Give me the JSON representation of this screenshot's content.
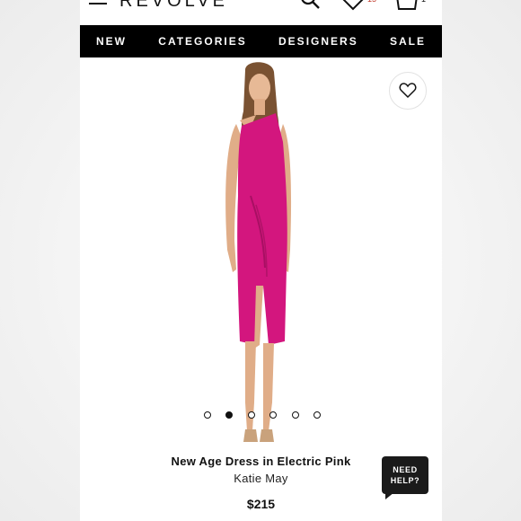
{
  "header": {
    "logo": "REVOLVE",
    "wishlist_count": "15",
    "bag_count": "1"
  },
  "nav": {
    "items": [
      {
        "label": "NEW"
      },
      {
        "label": "CATEGORIES"
      },
      {
        "label": "DESIGNERS"
      },
      {
        "label": "SALE"
      }
    ]
  },
  "carousel": {
    "total_dots": 6,
    "active_index": 1
  },
  "product": {
    "name": "New Age Dress in Electric Pink",
    "brand": "Katie May",
    "price": "$215",
    "dress_color": "#d3167e"
  },
  "help": {
    "line1": "NEED",
    "line2": "HELP?"
  }
}
